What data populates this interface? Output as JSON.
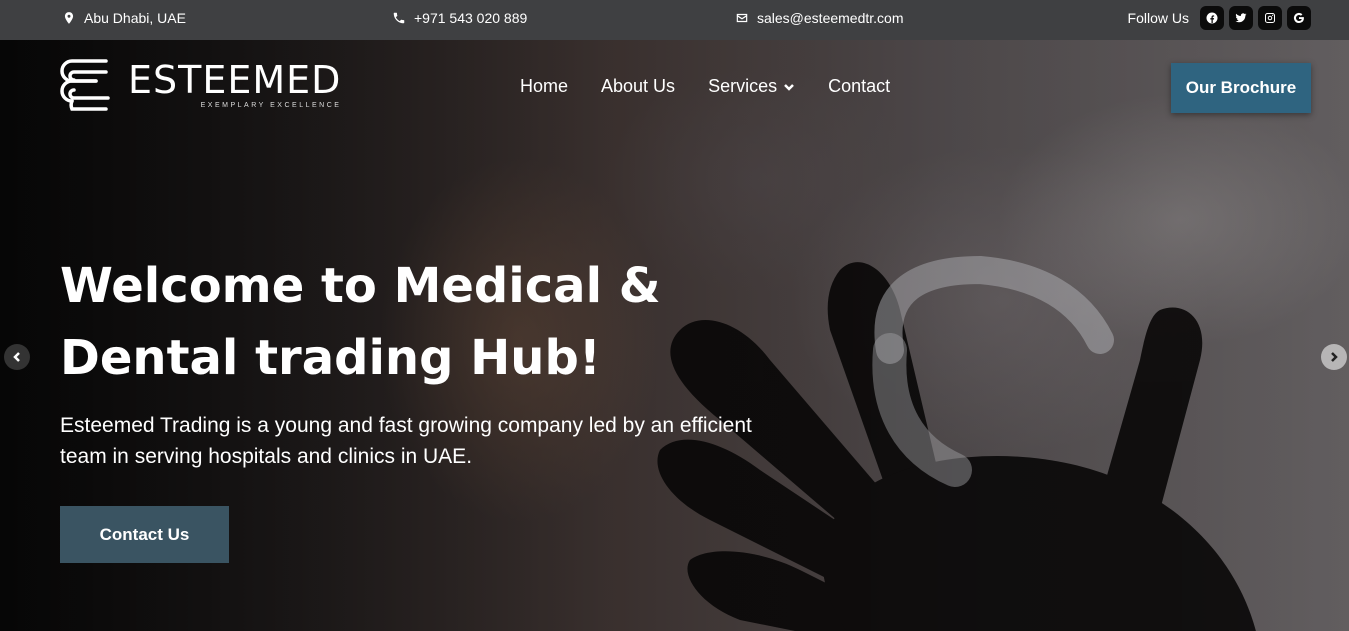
{
  "topbar": {
    "location": "Abu Dhabi, UAE",
    "phone": "+971 543 020 889",
    "email": "sales@esteemedtr.com",
    "follow_label": "Follow Us",
    "social_icons": [
      "facebook-icon",
      "twitter-icon",
      "instagram-icon",
      "google-icon"
    ]
  },
  "header": {
    "logo_name": "ESTEEMED",
    "logo_tagline": "EXEMPLARY EXCELLENCE",
    "nav": [
      "Home",
      "About Us",
      "Services",
      "Contact"
    ],
    "brochure_label": "Our Brochure"
  },
  "hero": {
    "title": "Welcome to Medical & Dental trading Hub!",
    "description": "Esteemed Trading is a young and fast growing company led by an efficient team in serving hospitals and clinics in UAE.",
    "cta_label": "Contact Us"
  },
  "colors": {
    "topbar_bg": "#3f4042",
    "brochure_bg": "#2f6480",
    "cta_bg": "#3a5462"
  }
}
